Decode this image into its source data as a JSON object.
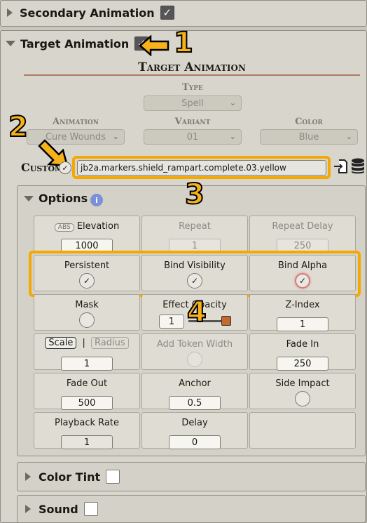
{
  "secondary_animation": {
    "label": "Secondary Animation",
    "checked": true
  },
  "target_animation": {
    "label": "Target Animation",
    "checked": true,
    "title": "Target Animation"
  },
  "type_field": {
    "label": "Type",
    "value": "Spell"
  },
  "animation_field": {
    "label": "Animation",
    "value": "Cure Wounds"
  },
  "variant_field": {
    "label": "Variant",
    "value": "01"
  },
  "color_field": {
    "label": "Color",
    "value": "Blue"
  },
  "custom": {
    "label": "Custom",
    "checked": true,
    "path": "jb2a.markers.shield_rampart.complete.03.yellow"
  },
  "options": {
    "title": "Options",
    "info_glyph": "i",
    "abs_label": "ABS",
    "elevation_label": "Elevation",
    "elevation_value": "1000",
    "repeat_label": "Repeat",
    "repeat_value": "1",
    "repeat_delay_label": "Repeat Delay",
    "repeat_delay_value": "250",
    "persistent_label": "Persistent",
    "bind_visibility_label": "Bind Visibility",
    "bind_alpha_label": "Bind Alpha",
    "mask_label": "Mask",
    "effect_opacity_label": "Effect Opacity",
    "effect_opacity_value": "1",
    "z_index_label": "Z-Index",
    "z_index_value": "1",
    "scale_label": "Scale",
    "separator": "|",
    "radius_label": "Radius",
    "scale_value": "1",
    "add_token_width_label": "Add Token Width",
    "fade_in_label": "Fade In",
    "fade_in_value": "250",
    "fade_out_label": "Fade Out",
    "fade_out_value": "500",
    "anchor_label": "Anchor",
    "anchor_value": "0.5",
    "side_impact_label": "Side Impact",
    "playback_rate_label": "Playback Rate",
    "playback_rate_value": "1",
    "delay_label": "Delay",
    "delay_value": "0"
  },
  "color_tint": {
    "label": "Color Tint",
    "checked": false
  },
  "sound": {
    "label": "Sound",
    "checked": false
  },
  "callouts": {
    "one": "1",
    "two": "2",
    "three": "3",
    "four": "4"
  },
  "colors": {
    "accent": "#f5a800",
    "panel": "#d8d6cc",
    "info": "#7d8fd6"
  }
}
